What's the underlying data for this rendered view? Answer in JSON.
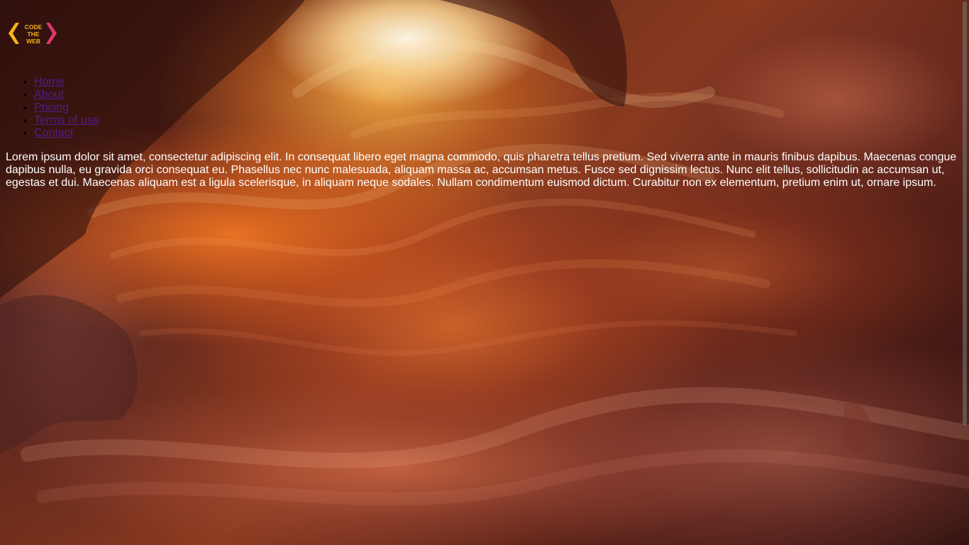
{
  "logo": {
    "text_line1": "CODE",
    "text_line2": "THE",
    "text_line3": "WEB",
    "colors": {
      "left_chevron": "#f6b21a",
      "right_chevron": "#e0366f",
      "text": "#f6b21a"
    }
  },
  "nav": {
    "items": [
      {
        "label": "Home"
      },
      {
        "label": "About"
      },
      {
        "label": "Pricing"
      },
      {
        "label": "Terms of use"
      },
      {
        "label": "Contact"
      }
    ]
  },
  "main": {
    "paragraph": "Lorem ipsum dolor sit amet, consectetur adipiscing elit. In consequat libero eget magna commodo, quis pharetra tellus pretium. Sed viverra ante in mauris finibus dapibus. Maecenas congue dapibus nulla, eu gravida orci consequat eu. Phasellus nec nunc malesuada, aliquam massa ac, accumsan metus. Fusce sed dignissim lectus. Nunc elit tellus, sollicitudin ac accumsan ut, egestas et dui. Maecenas aliquam est a ligula scelerisque, in aliquam neque sodales. Nullam condimentum euismod dictum. Curabitur non ex elementum, pretium enim ut, ornare ipsum."
  },
  "theme": {
    "link_color": "#551a8b",
    "text_color": "#ffffff"
  }
}
